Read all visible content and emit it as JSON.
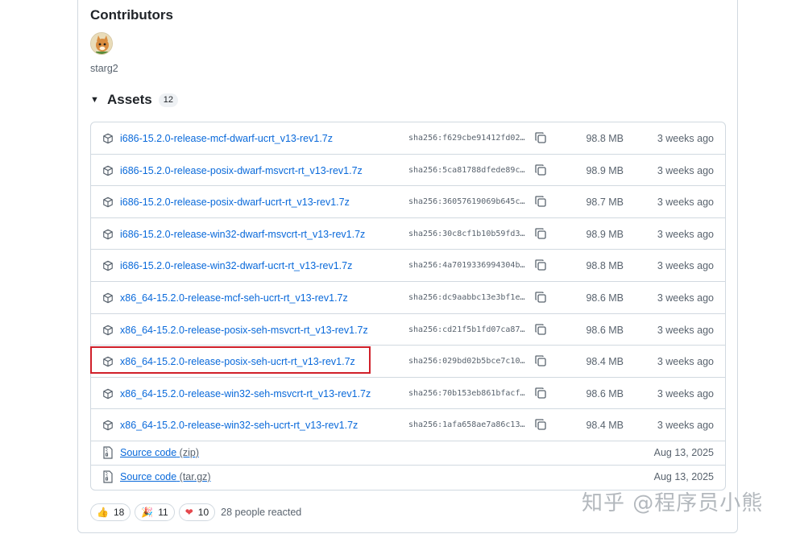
{
  "contributors": {
    "title": "Contributors",
    "users": [
      {
        "name": "starg2"
      }
    ]
  },
  "assets": {
    "title": "Assets",
    "count": "12",
    "files": [
      {
        "name": "i686-15.2.0-release-mcf-dwarf-ucrt_v13-rev1.7z",
        "sha": "sha256:f629cbe91412fd02…",
        "size": "98.8 MB",
        "date": "3 weeks ago"
      },
      {
        "name": "i686-15.2.0-release-posix-dwarf-msvcrt-rt_v13-rev1.7z",
        "sha": "sha256:5ca81788dfede89c…",
        "size": "98.9 MB",
        "date": "3 weeks ago"
      },
      {
        "name": "i686-15.2.0-release-posix-dwarf-ucrt-rt_v13-rev1.7z",
        "sha": "sha256:36057619069b645c…",
        "size": "98.7 MB",
        "date": "3 weeks ago"
      },
      {
        "name": "i686-15.2.0-release-win32-dwarf-msvcrt-rt_v13-rev1.7z",
        "sha": "sha256:30c8cf1b10b59fd3…",
        "size": "98.9 MB",
        "date": "3 weeks ago"
      },
      {
        "name": "i686-15.2.0-release-win32-dwarf-ucrt-rt_v13-rev1.7z",
        "sha": "sha256:4a7019336994304b…",
        "size": "98.8 MB",
        "date": "3 weeks ago"
      },
      {
        "name": "x86_64-15.2.0-release-mcf-seh-ucrt-rt_v13-rev1.7z",
        "sha": "sha256:dc9aabbc13e3bf1e…",
        "size": "98.6 MB",
        "date": "3 weeks ago"
      },
      {
        "name": "x86_64-15.2.0-release-posix-seh-msvcrt-rt_v13-rev1.7z",
        "sha": "sha256:cd21f5b1fd07ca87…",
        "size": "98.6 MB",
        "date": "3 weeks ago"
      },
      {
        "name": "x86_64-15.2.0-release-posix-seh-ucrt-rt_v13-rev1.7z",
        "sha": "sha256:029bd02b5bce7c10…",
        "size": "98.4 MB",
        "date": "3 weeks ago"
      },
      {
        "name": "x86_64-15.2.0-release-win32-seh-msvcrt-rt_v13-rev1.7z",
        "sha": "sha256:70b153eb861bfacf…",
        "size": "98.6 MB",
        "date": "3 weeks ago"
      },
      {
        "name": "x86_64-15.2.0-release-win32-seh-ucrt-rt_v13-rev1.7z",
        "sha": "sha256:1afa658ae7a86c13…",
        "size": "98.4 MB",
        "date": "3 weeks ago"
      }
    ],
    "source": [
      {
        "label": "Source code",
        "format": "(zip)",
        "date": "Aug 13, 2025"
      },
      {
        "label": "Source code",
        "format": "(tar.gz)",
        "date": "Aug 13, 2025"
      }
    ]
  },
  "reactions": {
    "items": [
      {
        "emoji": "👍",
        "count": "18"
      },
      {
        "emoji": "🎉",
        "count": "11"
      },
      {
        "emoji": "❤",
        "count": "10"
      }
    ],
    "summary": "28 people reacted"
  },
  "watermark": "知乎 @程序员小熊",
  "colors": {
    "link": "#0969da",
    "highlight": "#d0202a",
    "border": "#d1d9e0",
    "muted": "#59636e"
  }
}
